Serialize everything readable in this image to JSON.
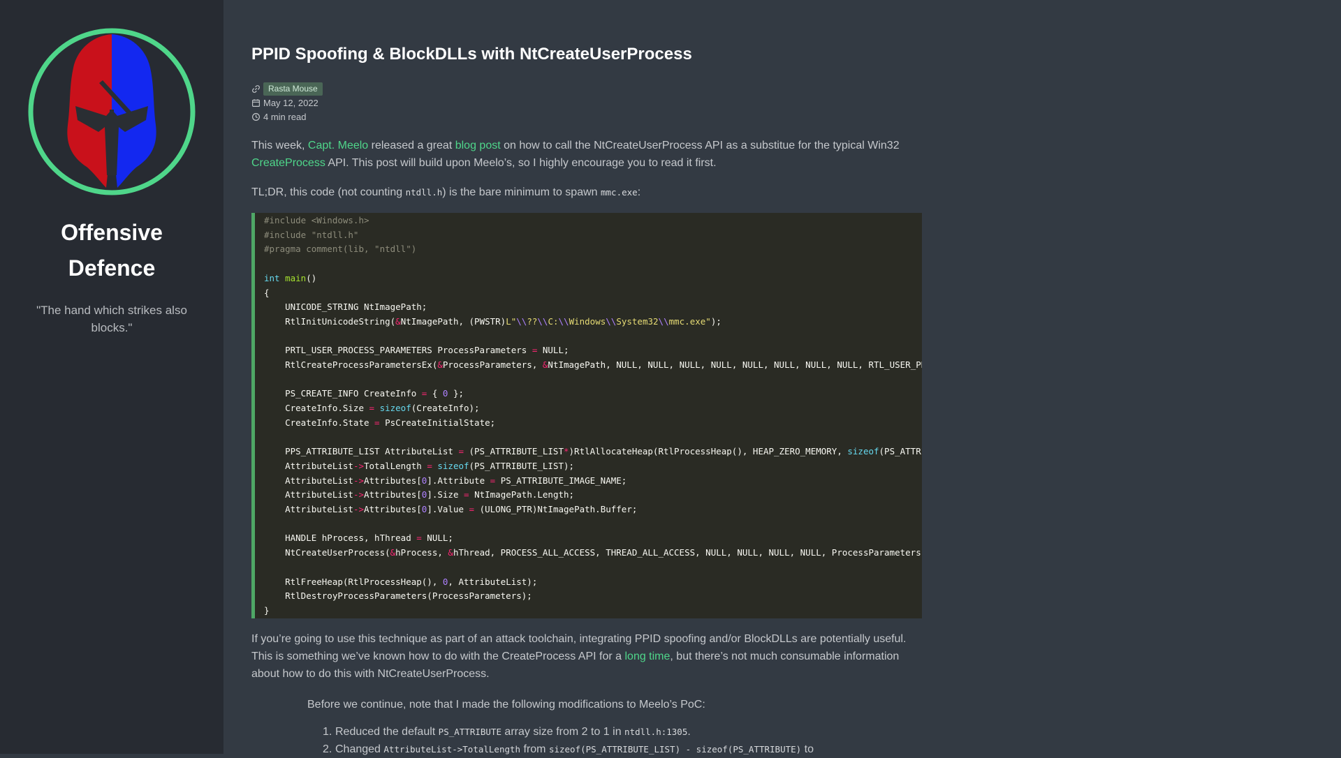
{
  "sidebar": {
    "title_line1": "Offensive",
    "title_line2": "Defence",
    "tagline": "\"The hand which strikes also blocks.\"",
    "logo_colors": {
      "ring": "#4fd68a",
      "left": "#c9111b",
      "right": "#1328f0"
    }
  },
  "post": {
    "title": "PPID Spoofing & BlockDLLs with NtCreateUserProcess",
    "author": "Rasta Mouse",
    "date": "May 12, 2022",
    "read_time": "4 min read",
    "intro": {
      "t1": "This week, ",
      "link1": "Capt. Meelo",
      "t2": " released a great ",
      "link2": "blog post",
      "t3": " on how to call the NtCreateUserProcess API as a substitue for the typical Win32 ",
      "link3": "CreateProcess",
      "t4": " API. This post will build upon Meelo’s, so I highly encourage you to read it first."
    },
    "tldr": {
      "t1": "TL;DR, this code (not counting ",
      "code1": "ntdll.h",
      "t2": ") is the bare minimum to spawn ",
      "code2": "mmc.exe",
      "t3": ":"
    },
    "toolchain": {
      "t1": "If you’re going to use this technique as part of an attack toolchain, integrating PPID spoofing and/or BlockDLLs are potentially useful. This is something we’ve known how to do with the CreateProcess API for a ",
      "link": "long time",
      "t2": ", but there’s not much consumable information about how to do this with NtCreateUserProcess."
    },
    "note_intro": "Before we continue, note that I made the following modifications to Meelo’s PoC:",
    "mods": [
      {
        "num": "1.",
        "t1": "Reduced the default ",
        "code1": "PS_ATTRIBUTE",
        "t2": " array size from 2 to 1 in ",
        "code2": "ntdll.h:1305",
        "t3": "."
      },
      {
        "num": "2.",
        "t1": "Changed ",
        "code1": "AttributeList->TotalLength",
        "t2": " from ",
        "code2": "sizeof(PS_ATTRIBUTE_LIST) - sizeof(PS_ATTRIBUTE)",
        "t3": " to"
      }
    ]
  },
  "code": {
    "inc1": "#include <Windows.h>",
    "inc2": "#include \"ntdll.h\"",
    "pragma": "#pragma comment(lib, \"ntdll\")"
  }
}
